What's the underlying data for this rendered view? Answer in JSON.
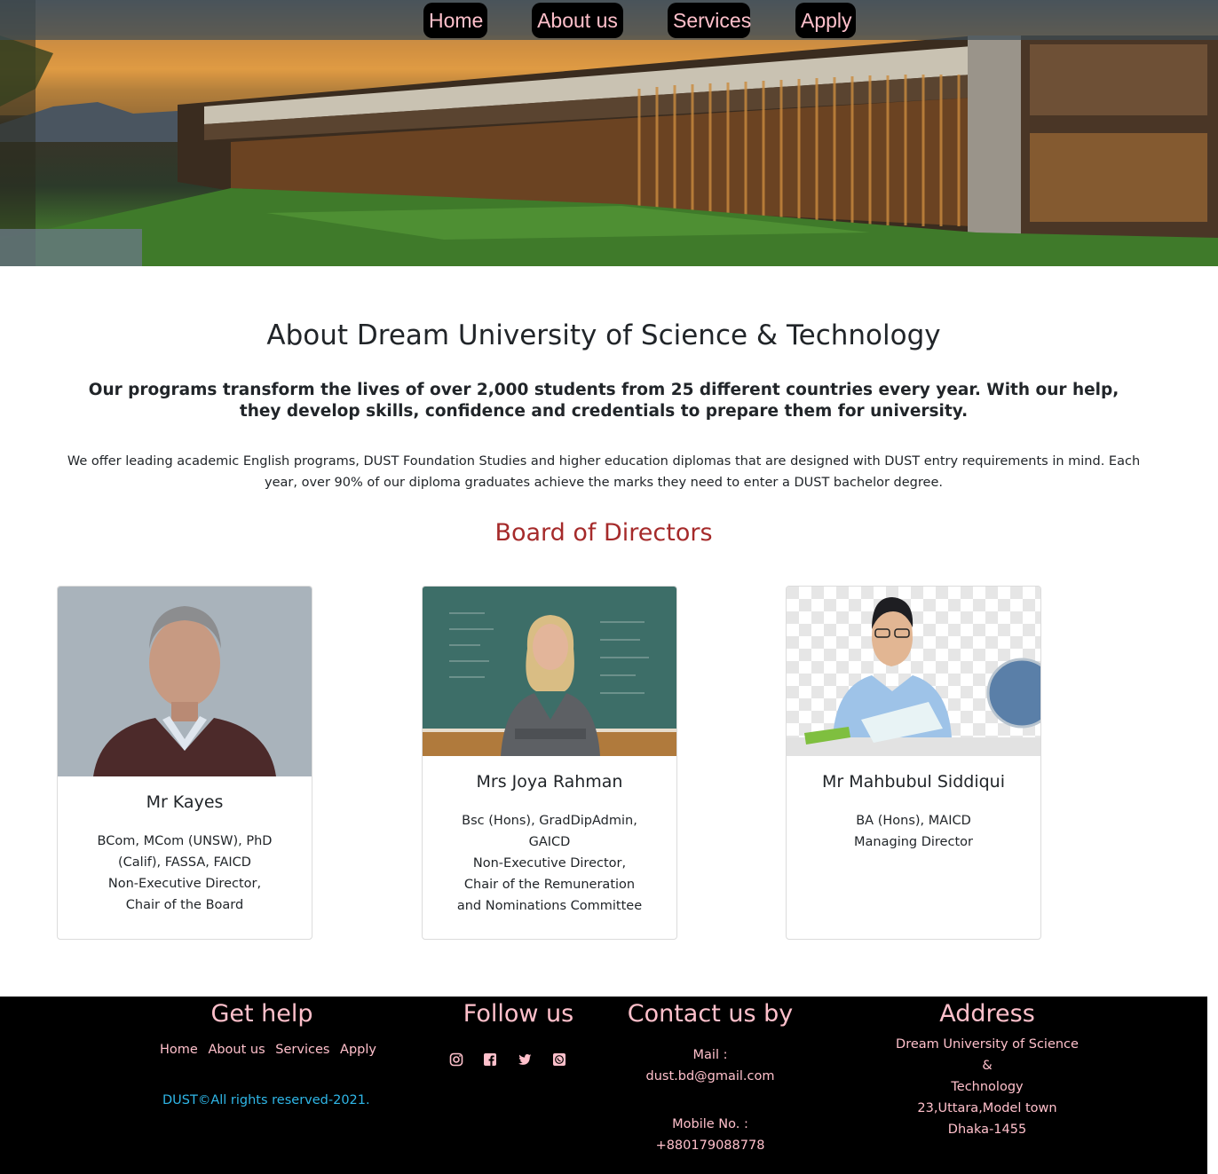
{
  "nav": {
    "home": "Home",
    "about": "About us",
    "services": "Services",
    "apply": "Apply"
  },
  "about": {
    "title": "About Dream University of Science & Technology",
    "lead": "Our programs transform the lives of over 2,000 students from 25 different countries every year. With our help, they develop skills, confidence and credentials to prepare them for university.",
    "body": "We offer leading academic English programs, DUST Foundation Studies and higher education diplomas that are designed with DUST entry requirements in mind. Each year, over 90% of our diploma graduates achieve the marks they need to enter a DUST bachelor degree."
  },
  "board": {
    "title": "Board of Directors",
    "members": [
      {
        "name": "Mr Kayes",
        "lines": [
          "BCom, MCom (UNSW), PhD",
          "(Calif), FASSA, FAICD",
          "Non-Executive Director,",
          "Chair of the Board"
        ]
      },
      {
        "name": "Mrs Joya Rahman",
        "lines": [
          "Bsc (Hons), GradDipAdmin,",
          "GAICD",
          "Non-Executive Director,",
          "Chair of the Remuneration",
          "and Nominations Committee"
        ]
      },
      {
        "name": "Mr Mahbubul Siddiqui",
        "lines": [
          "BA (Hons), MAICD",
          "Managing Director"
        ]
      }
    ]
  },
  "footer": {
    "get_help": {
      "heading": "Get help",
      "links": [
        "Home",
        "About us",
        "Services",
        "Apply"
      ],
      "copyright": "DUST©All rights reserved-2021."
    },
    "follow": {
      "heading": "Follow us",
      "icons": [
        "instagram-icon",
        "facebook-icon",
        "twitter-icon",
        "whatsapp-icon"
      ]
    },
    "contact": {
      "heading": "Contact us by",
      "mail_label": "Mail :",
      "mail": "dust.bd@gmail.com",
      "mobile_label": "Mobile No. :",
      "mobile": "+880179088778"
    },
    "address": {
      "heading": "Address",
      "lines": [
        "Dream University of Science",
        "&",
        "Technology",
        "23,Uttara,Model town",
        "Dhaka-1455"
      ]
    }
  },
  "colors": {
    "nav_text": "#ffc0cb",
    "board_title": "#a52a2a",
    "footer_bg": "#000000",
    "footer_text": "#ffc0cb",
    "copyright": "#2fb7e8"
  }
}
